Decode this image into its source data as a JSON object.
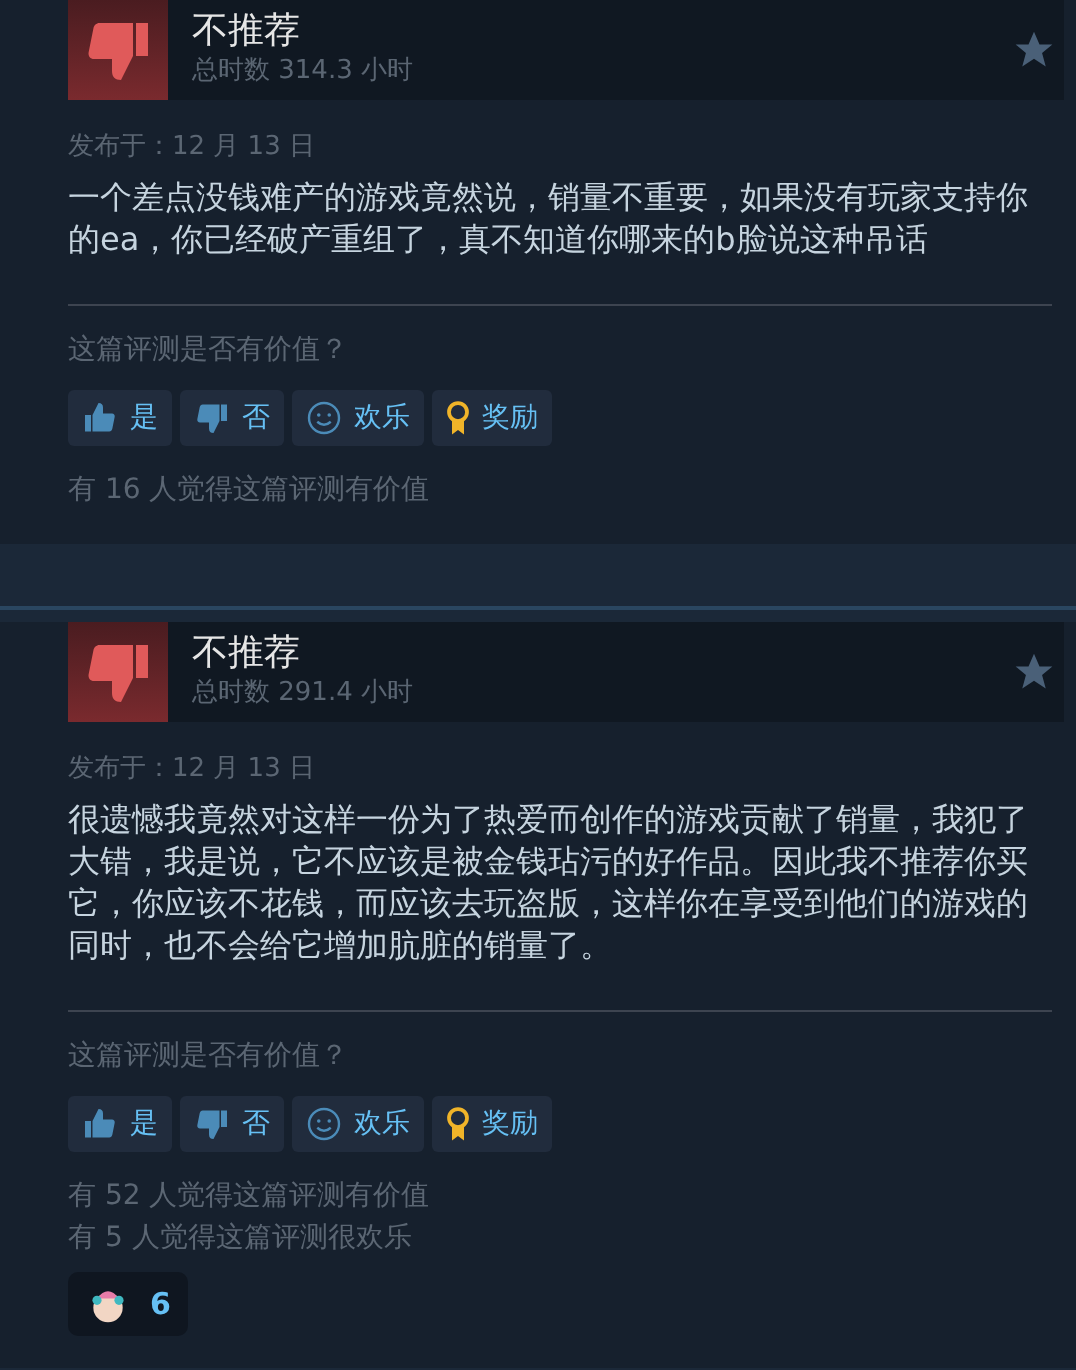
{
  "reviews": [
    {
      "verdict": "不推荐",
      "recommended": false,
      "hours": "总时数 314.3 小时",
      "date": "发布于：12 月 13 日",
      "body": "一个差点没钱难产的游戏竟然说，销量不重要，如果没有玩家支持你的ea，你已经破产重组了，真不知道你哪来的b脸说这种吊话",
      "question": "这篇评测是否有价值？",
      "buttons": [
        {
          "kind": "yes",
          "label": "是"
        },
        {
          "kind": "no",
          "label": "否"
        },
        {
          "kind": "funny",
          "label": "欢乐"
        },
        {
          "kind": "award",
          "label": "奖励"
        }
      ],
      "counts": [
        "有 16 人觉得这篇评测有价值"
      ]
    },
    {
      "verdict": "不推荐",
      "recommended": false,
      "hours": "总时数 291.4 小时",
      "date": "发布于：12 月 13 日",
      "body": "很遗憾我竟然对这样一份为了热爱而创作的游戏贡献了销量，我犯了大错，我是说，它不应该是被金钱玷污的好作品。因此我不推荐你买它，你应该不花钱，而应该去玩盗版，这样你在享受到他们的游戏的同时，也不会给它增加肮脏的销量了。",
      "question": "这篇评测是否有价值？",
      "buttons": [
        {
          "kind": "yes",
          "label": "是"
        },
        {
          "kind": "no",
          "label": "否"
        },
        {
          "kind": "funny",
          "label": "欢乐"
        },
        {
          "kind": "award",
          "label": "奖励"
        }
      ],
      "counts": [
        "有 52 人觉得这篇评测有价值",
        "有 5 人觉得这篇评测很欢乐"
      ],
      "awards": [
        {
          "count": "6"
        }
      ]
    }
  ]
}
